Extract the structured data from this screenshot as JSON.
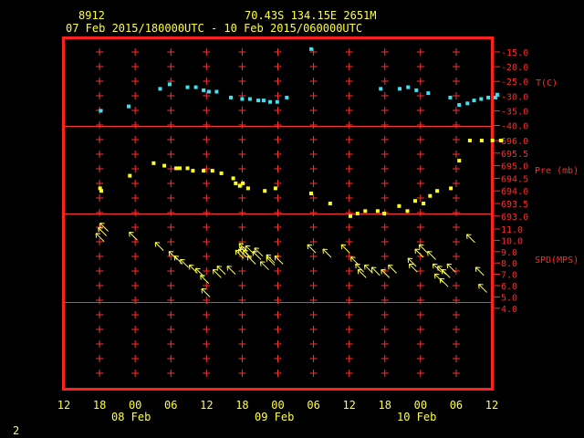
{
  "header": {
    "station_id": "8912",
    "location": "70.43S  134.15E  2651M",
    "time_range": "07 Feb 2015/180000UTC - 10 Feb 2015/060000UTC"
  },
  "page_number": "2",
  "colors": {
    "frame": "#ff2020",
    "grid": "#ff3030",
    "temperature": "#40e0f0",
    "pressure": "#ffff20",
    "wind": "#ffff40",
    "text": "#ffff40",
    "axis_text": "#ff2a2a",
    "background": "#000000"
  },
  "x_axis": {
    "tick_labels": [
      "12",
      "18",
      "00",
      "06",
      "12",
      "18",
      "00",
      "06",
      "12",
      "18",
      "00",
      "06",
      "12"
    ],
    "date_labels": [
      "08 Feb",
      "09 Feb",
      "10 Feb"
    ]
  },
  "panels": {
    "temperature": {
      "label": "T(C)",
      "ticks": [
        "-15.0",
        "-20.0",
        "-25.0",
        "-30.0",
        "-35.0",
        "-40.0"
      ]
    },
    "pressure": {
      "label": "Pre (mb)",
      "ticks": [
        "696.0",
        "695.5",
        "695.0",
        "694.5",
        "694.0",
        "693.5",
        "693.0"
      ]
    },
    "wind": {
      "label": "SPD(MPS)",
      "ticks": [
        "11.0",
        "10.0",
        "9.0",
        "8.0",
        "7.0",
        "6.0",
        "5.0",
        "4.0"
      ]
    }
  },
  "chart_data": [
    {
      "type": "scatter",
      "ylabel": "T(C)",
      "xlim": [
        12,
        84
      ],
      "ylim": [
        -40,
        -12.5
      ],
      "x_unit": "hours since 07 Feb 2015 00 UTC",
      "x": [
        18.2,
        22.9,
        28.2,
        29.8,
        32.8,
        34.2,
        35.5,
        36.4,
        37.7,
        40.1,
        42.0,
        43.3,
        44.7,
        45.6,
        46.7,
        47.9,
        49.5,
        53.6,
        65.3,
        68.5,
        69.9,
        71.3,
        73.3,
        77.0,
        78.5,
        79.9,
        81.0,
        82.2,
        83.4,
        84.6,
        84.9
      ],
      "y": [
        -35.0,
        -33.5,
        -27.5,
        -26.0,
        -27.0,
        -27.0,
        -28.0,
        -28.5,
        -28.5,
        -30.5,
        -31.0,
        -31.0,
        -31.5,
        -31.5,
        -32.0,
        -32.0,
        -30.5,
        -14.0,
        -27.5,
        -27.5,
        -27.0,
        -28.0,
        -29.0,
        -30.5,
        -33.0,
        -32.5,
        -31.5,
        -31.0,
        -30.5,
        -30.5,
        -29.5
      ]
    },
    {
      "type": "scatter",
      "ylabel": "Pre (mb)",
      "xlim": [
        12,
        84
      ],
      "ylim": [
        693,
        696.3
      ],
      "x_unit": "hours since 07 Feb 2015 00 UTC",
      "x": [
        18.1,
        18.3,
        23.1,
        27.1,
        28.9,
        30.9,
        31.5,
        32.8,
        33.7,
        35.5,
        37.0,
        38.5,
        40.5,
        40.9,
        41.6,
        42.1,
        43.0,
        45.8,
        47.6,
        53.6,
        56.8,
        60.2,
        61.4,
        62.7,
        64.8,
        65.9,
        68.4,
        69.8,
        71.1,
        72.5,
        73.6,
        74.8,
        77.1,
        78.5,
        80.3,
        82.3,
        84.1,
        85.5,
        85.6
      ],
      "y": [
        694.1,
        694.0,
        694.6,
        695.1,
        695.0,
        694.9,
        694.9,
        694.9,
        694.8,
        694.8,
        694.8,
        694.7,
        694.5,
        694.3,
        694.2,
        694.3,
        694.1,
        694.0,
        694.1,
        693.9,
        693.5,
        693.0,
        693.1,
        693.2,
        693.2,
        693.1,
        693.4,
        693.2,
        693.6,
        693.5,
        693.8,
        694.0,
        694.1,
        695.2,
        696.0,
        696.0,
        696.0,
        696.0,
        696.0
      ],
      "note": "values read from the plotted points"
    },
    {
      "type": "scatter",
      "ylabel": "SPD(MPS)",
      "xlim": [
        12,
        84
      ],
      "ylim": [
        4,
        11.5
      ],
      "x_unit": "hours since 07 Feb 2015 00 UTC",
      "x": [
        18.0,
        18.4,
        18.7,
        23.6,
        28.0,
        30.3,
        31.2,
        32.2,
        33.7,
        34.8,
        35.6,
        35.8,
        37.7,
        38.4,
        40.1,
        41.5,
        42.0,
        42.1,
        42.3,
        42.8,
        43.2,
        43.5,
        44.4,
        44.7,
        45.7,
        46.7,
        46.7,
        48.1,
        53.6,
        56.2,
        59.3,
        60.9,
        61.7,
        62.1,
        63.2,
        64.4,
        66.0,
        67.2,
        70.5,
        70.7,
        71.7,
        72.4,
        73.8,
        74.7,
        75.0,
        75.5,
        75.9,
        76.2,
        77.1,
        80.4,
        81.9,
        82.4
      ],
      "y": [
        10.3,
        10.8,
        11.2,
        10.4,
        9.5,
        8.7,
        8.3,
        8.0,
        7.5,
        7.2,
        6.6,
        5.4,
        7.1,
        7.4,
        7.4,
        8.8,
        8.9,
        9.4,
        9.1,
        8.8,
        9.2,
        8.3,
        8.7,
        9.0,
        7.8,
        8.2,
        8.4,
        8.3,
        9.3,
        8.9,
        9.3,
        8.2,
        7.6,
        7.1,
        7.5,
        7.3,
        7.1,
        7.5,
        8.1,
        7.6,
        8.9,
        9.3,
        8.7,
        7.6,
        6.7,
        7.4,
        6.3,
        7.1,
        7.6,
        10.2,
        7.3,
        5.8
      ]
    }
  ]
}
